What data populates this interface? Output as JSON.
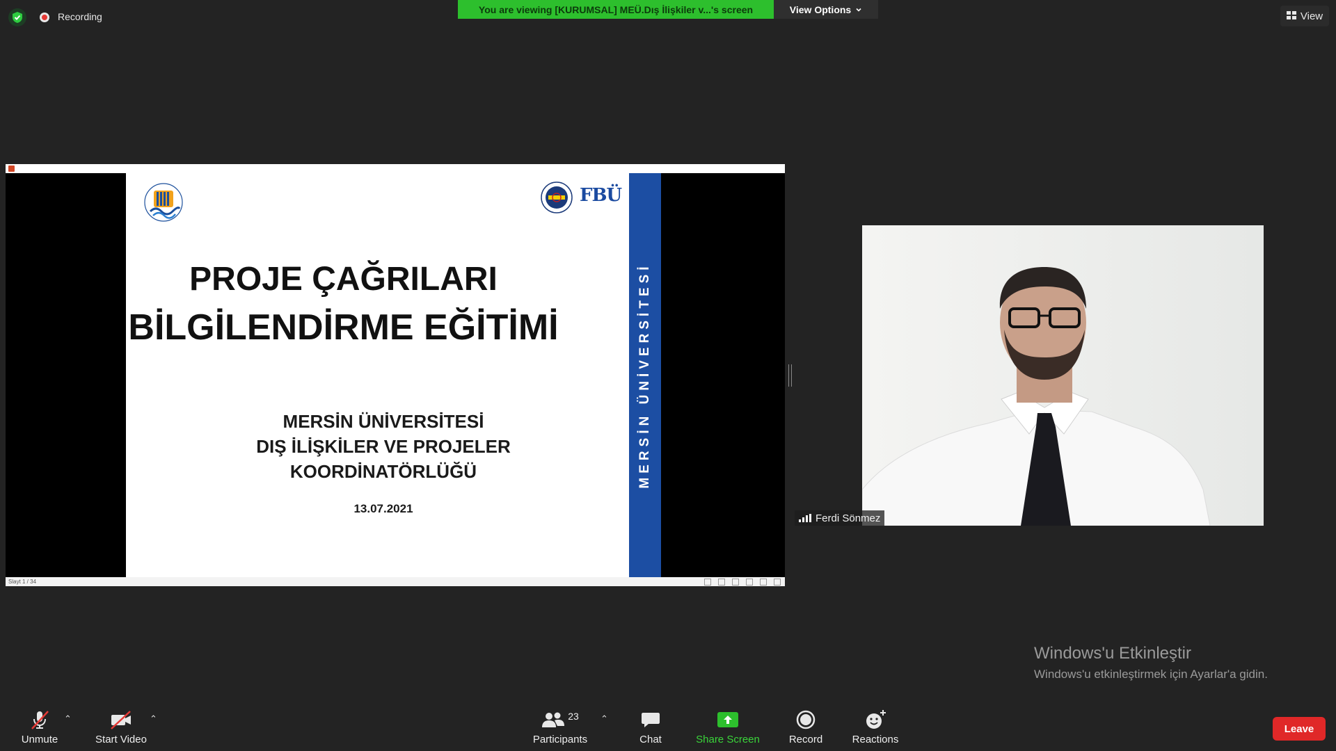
{
  "top": {
    "recording_label": "Recording",
    "viewing_banner": "You are viewing [KURUMSAL] MEÜ.Dış İlişkiler v...'s screen",
    "view_options_label": "View Options",
    "view_label": "View"
  },
  "slide": {
    "title_line1": "PROJE ÇAĞRILARI",
    "title_line2": "BİLGİLENDİRME EĞİTİMİ",
    "subtitle_line1": "MERSİN ÜNİVERSİTESİ",
    "subtitle_line2": "DIŞ İLİŞKİLER VE PROJELER",
    "subtitle_line3": "KOORDİNATÖRLÜĞÜ",
    "date": "13.07.2021",
    "side_band_text": "MERSİN ÜNİVERSİTESİ",
    "partner_logo_text": "FBÜ",
    "status_text": "Slayt 1 / 34",
    "band_color": "#1c4ea3"
  },
  "participant": {
    "name": "Ferdi Sönmez"
  },
  "watermark": {
    "title": "Windows'u Etkinleştir",
    "subtitle": "Windows'u etkinleştirmek için Ayarlar'a gidin."
  },
  "toolbar": {
    "unmute_label": "Unmute",
    "start_video_label": "Start Video",
    "participants_label": "Participants",
    "participants_count": "23",
    "chat_label": "Chat",
    "share_screen_label": "Share Screen",
    "record_label": "Record",
    "reactions_label": "Reactions",
    "leave_label": "Leave",
    "share_color": "#2dbf2d",
    "leave_color": "#e02828"
  }
}
